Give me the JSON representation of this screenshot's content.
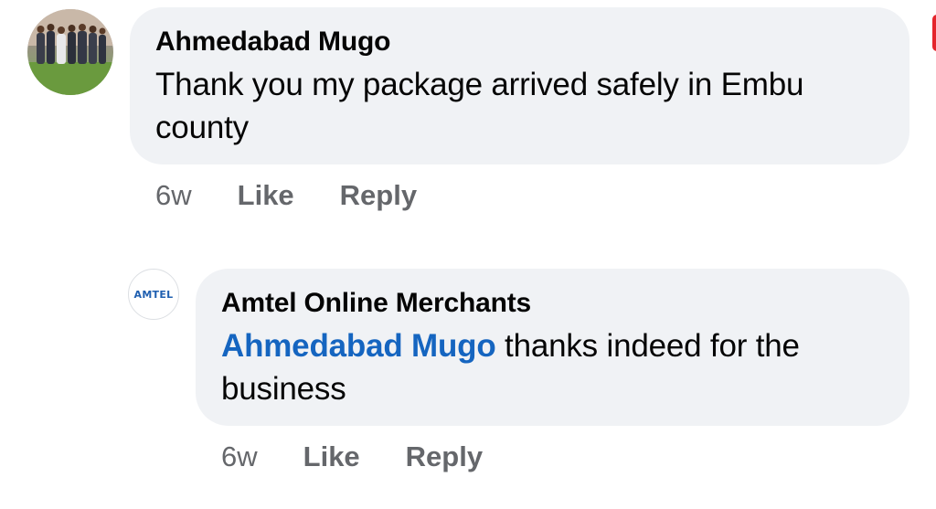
{
  "comments": [
    {
      "author": "Ahmedabad Mugo",
      "text": "Thank you my package arrived safely in Embu county",
      "time": "6w",
      "like_label": "Like",
      "reply_label": "Reply"
    },
    {
      "author": "Amtel Online Merchants",
      "avatar_logo_text": "AMTEL",
      "mention": "Ahmedabad Mugo",
      "text": " thanks indeed for the business",
      "time": "6w",
      "like_label": "Like",
      "reply_label": "Reply"
    }
  ],
  "colors": {
    "bubble": "#f0f2f5",
    "mention": "#1565c0",
    "meta": "#65676b",
    "text": "#050505"
  }
}
